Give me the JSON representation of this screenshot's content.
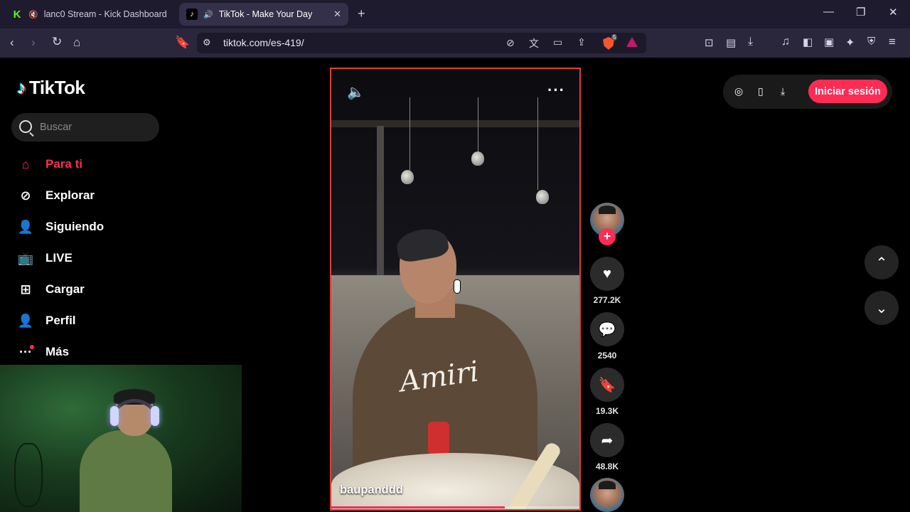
{
  "browser": {
    "tabs": [
      {
        "title": "lanc0 Stream - Kick Dashboard",
        "active": false
      },
      {
        "title": "TikTok - Make Your Day",
        "active": true
      }
    ],
    "url": "tiktok.com/es-419/",
    "shields_count": "5"
  },
  "sidebar": {
    "brand": "TikTok",
    "search_placeholder": "Buscar",
    "items": [
      {
        "label": "Para ti",
        "icon": "home-icon",
        "active": true
      },
      {
        "label": "Explorar",
        "icon": "compass-icon"
      },
      {
        "label": "Siguiendo",
        "icon": "following-icon"
      },
      {
        "label": "LIVE",
        "icon": "live-tv-icon"
      },
      {
        "label": "Cargar",
        "icon": "upload-plus-icon"
      },
      {
        "label": "Perfil",
        "icon": "profile-icon"
      },
      {
        "label": "Más",
        "icon": "more-dots-icon"
      }
    ]
  },
  "video": {
    "author": "baupanddd",
    "progress": 0.7
  },
  "actions": {
    "likes": "277.2K",
    "comments": "2540",
    "saves": "19.3K",
    "shares": "48.8K"
  },
  "header": {
    "login_label": "Iniciar sesión"
  },
  "colors": {
    "accent": "#fe2c55",
    "frame_outline": "#e03c3c"
  }
}
